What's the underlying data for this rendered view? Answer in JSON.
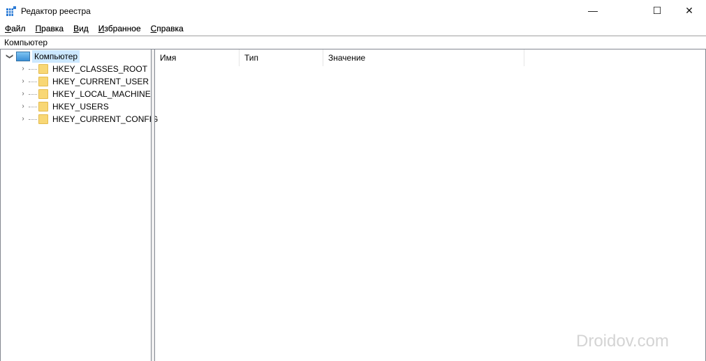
{
  "window": {
    "title": "Редактор реестра",
    "icon": "regedit-icon",
    "controls": [
      "minimize",
      "maximize",
      "close"
    ]
  },
  "menu": [
    {
      "label": "Файл",
      "accel": "Ф",
      "rest": "айл"
    },
    {
      "label": "Правка",
      "accel": "П",
      "rest": "равка"
    },
    {
      "label": "Вид",
      "accel": "В",
      "rest": "ид"
    },
    {
      "label": "Избранное",
      "accel": "И",
      "rest": "збранное"
    },
    {
      "label": "Справка",
      "accel": "С",
      "rest": "правка"
    }
  ],
  "address": "Компьютер",
  "tree": {
    "root": "Компьютер",
    "children": [
      "HKEY_CLASSES_ROOT",
      "HKEY_CURRENT_USER",
      "HKEY_LOCAL_MACHINE",
      "HKEY_USERS",
      "HKEY_CURRENT_CONFIG"
    ]
  },
  "columns": [
    "Имя",
    "Тип",
    "Значение"
  ],
  "watermark": "Droidov.com",
  "colors": {
    "selection": "#cce8ff",
    "folder": "#f8d775"
  }
}
